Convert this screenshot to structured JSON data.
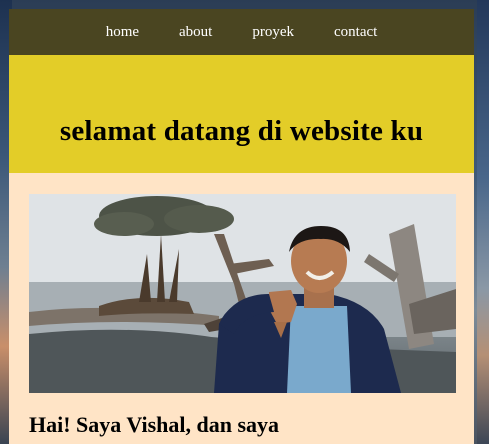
{
  "nav": {
    "items": [
      {
        "label": "home"
      },
      {
        "label": "about"
      },
      {
        "label": "proyek"
      },
      {
        "label": "contact"
      }
    ]
  },
  "hero": {
    "title": "selamat datang di website ku"
  },
  "profile": {
    "photo_icon": "profile-photo",
    "intro": "Hai! Saya Vishal, dan saya"
  },
  "colors": {
    "nav_bg": "#4a4521",
    "hero_bg": "#e3cd28",
    "page_bg": "#ffe4c6"
  }
}
